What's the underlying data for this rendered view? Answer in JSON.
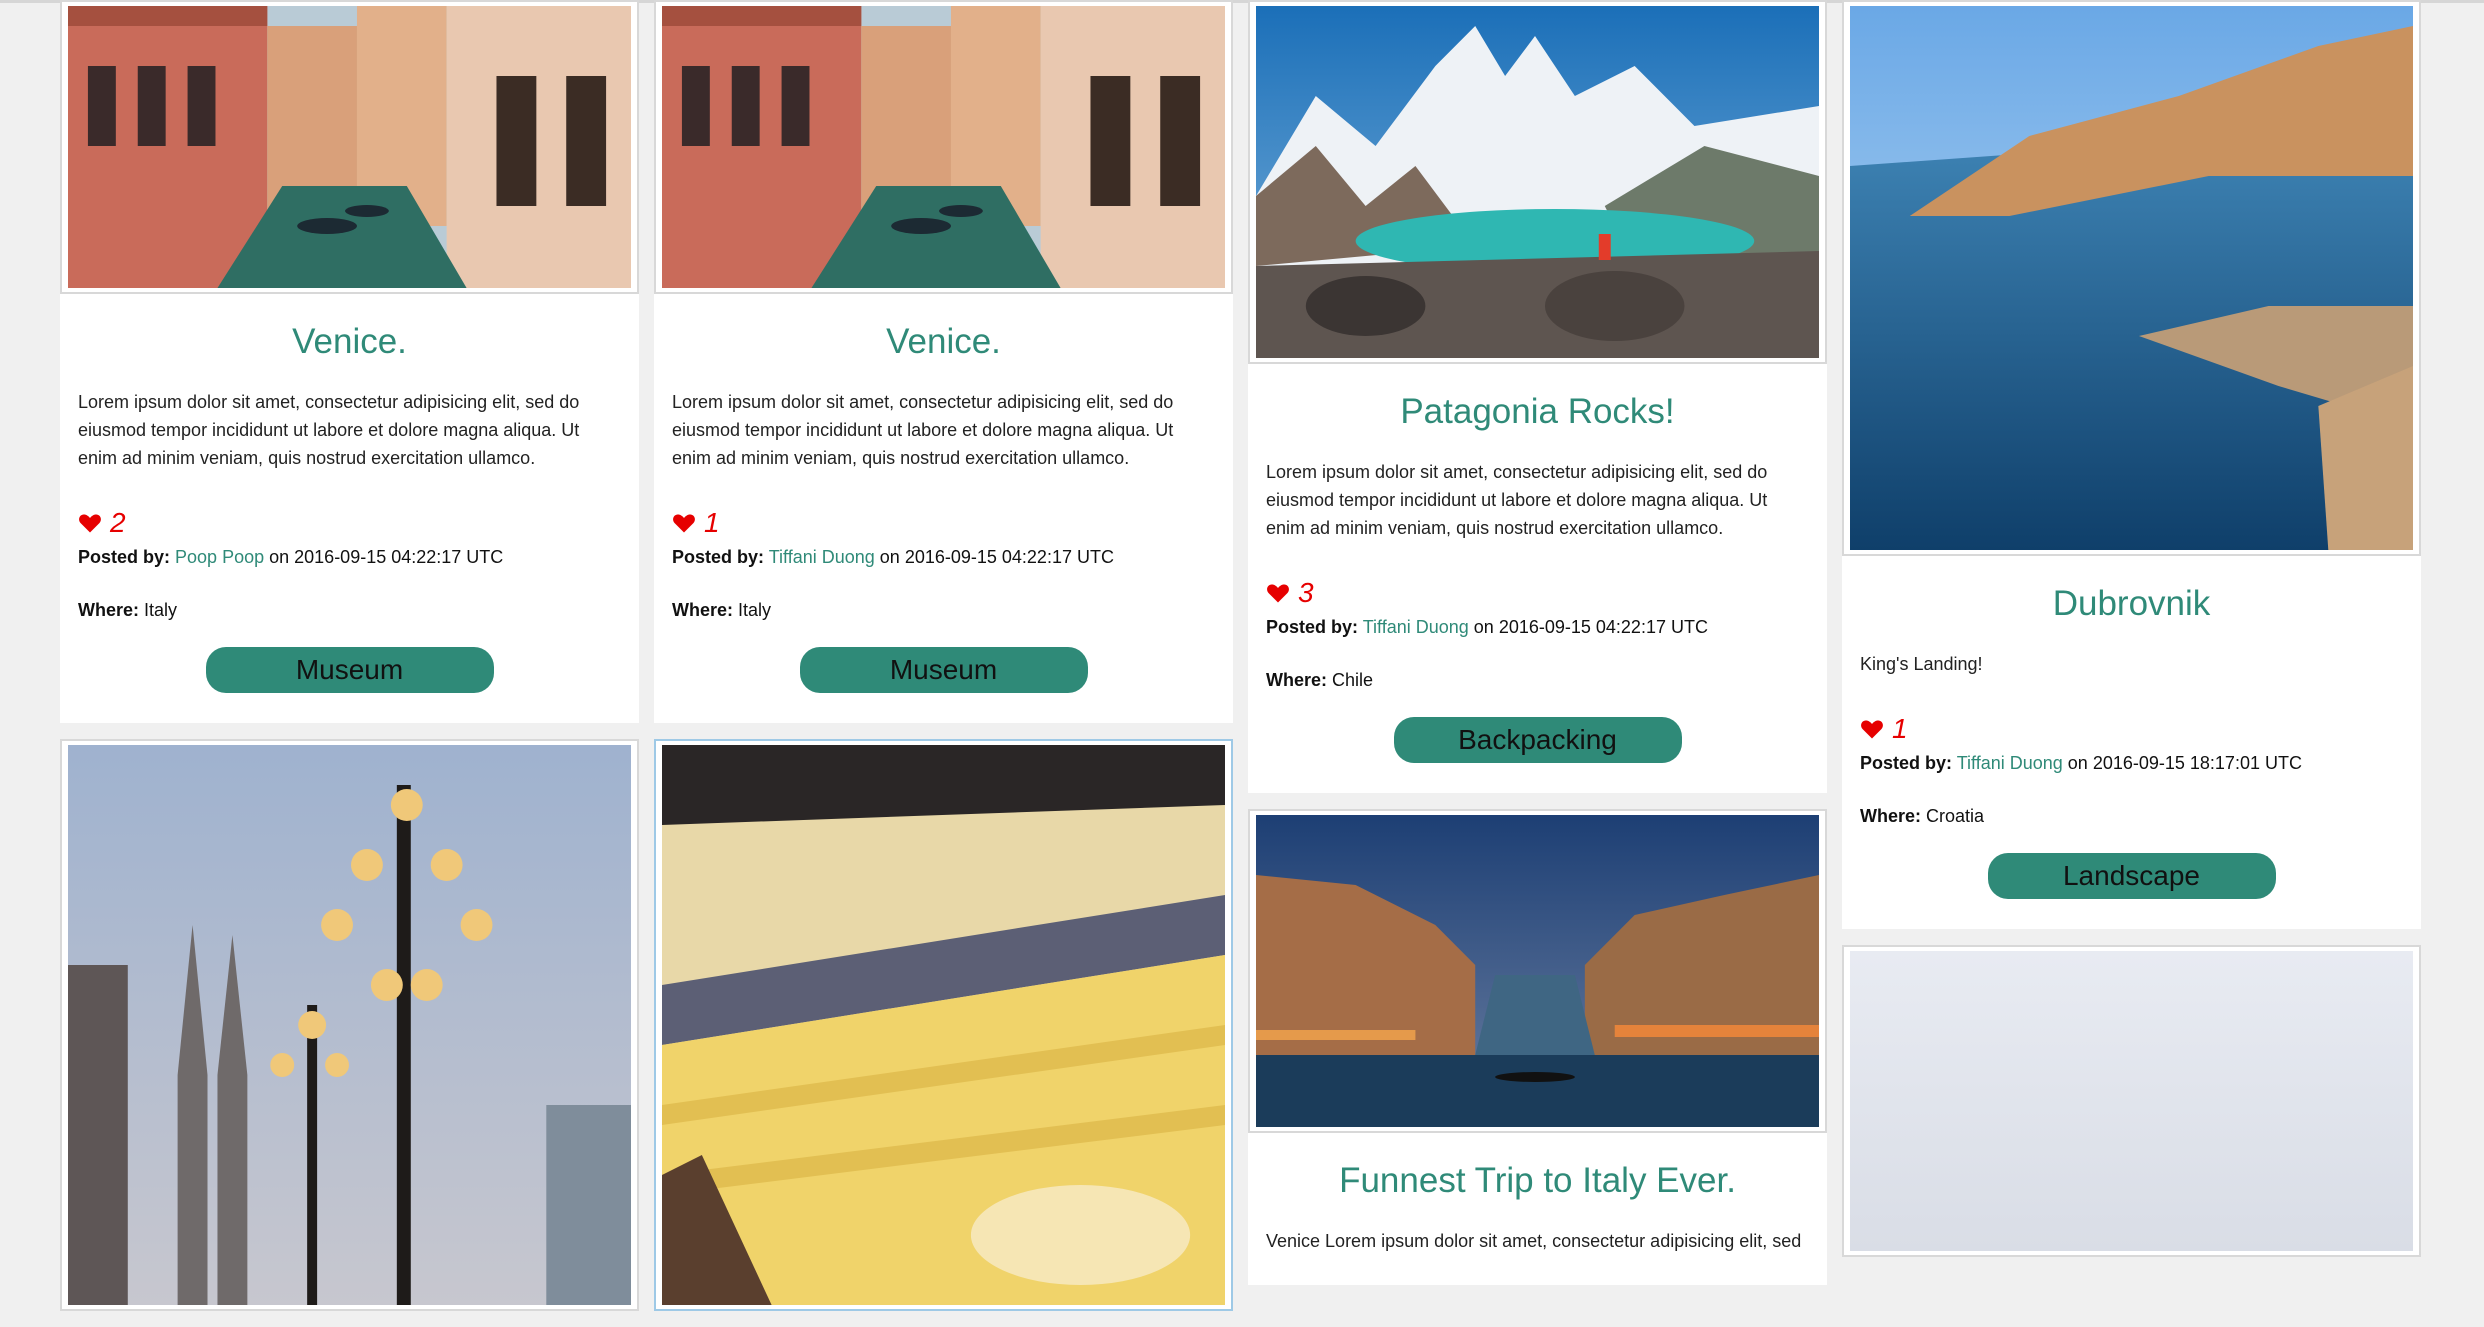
{
  "posts": [
    {
      "title": "Venice.",
      "description": "Lorem ipsum dolor sit amet, consectetur adipisicing elit, sed do eiusmod tempor incididunt ut labore et dolore magna aliqua. Ut enim ad minim veniam, quis nostrud exercitation ullamco.",
      "likes": "2",
      "posted_by_label": "Posted by:",
      "author": "Poop Poop",
      "timestamp": "on 2016-09-15 04:22:17 UTC",
      "where_label": "Where:",
      "location": "Italy",
      "tag": "Museum"
    },
    {
      "title": "Venice.",
      "description": "Lorem ipsum dolor sit amet, consectetur adipisicing elit, sed do eiusmod tempor incididunt ut labore et dolore magna aliqua. Ut enim ad minim veniam, quis nostrud exercitation ullamco.",
      "likes": "1",
      "posted_by_label": "Posted by:",
      "author": "Tiffani Duong",
      "timestamp": "on 2016-09-15 04:22:17 UTC",
      "where_label": "Where:",
      "location": "Italy",
      "tag": "Museum"
    },
    {
      "title": "Patagonia Rocks!",
      "description": "Lorem ipsum dolor sit amet, consectetur adipisicing elit, sed do eiusmod tempor incididunt ut labore et dolore magna aliqua. Ut enim ad minim veniam, quis nostrud exercitation ullamco.",
      "likes": "3",
      "posted_by_label": "Posted by:",
      "author": "Tiffani Duong",
      "timestamp": "on 2016-09-15 04:22:17 UTC",
      "where_label": "Where:",
      "location": "Chile",
      "tag": "Backpacking"
    },
    {
      "title": "Dubrovnik",
      "description": "King's Landing!",
      "likes": "1",
      "posted_by_label": "Posted by:",
      "author": "Tiffani Duong",
      "timestamp": "on 2016-09-15 18:17:01 UTC",
      "where_label": "Where:",
      "location": "Croatia",
      "tag": "Landscape"
    },
    {
      "title": "Funnest Trip to Italy Ever.",
      "description": "Venice Lorem ipsum dolor sit amet, consectetur adipisicing elit, sed"
    }
  ],
  "colors": {
    "accent": "#2f8a78",
    "heart": "#e60000",
    "background": "#f0f0f0"
  },
  "icons": {
    "like": "heart-icon"
  }
}
